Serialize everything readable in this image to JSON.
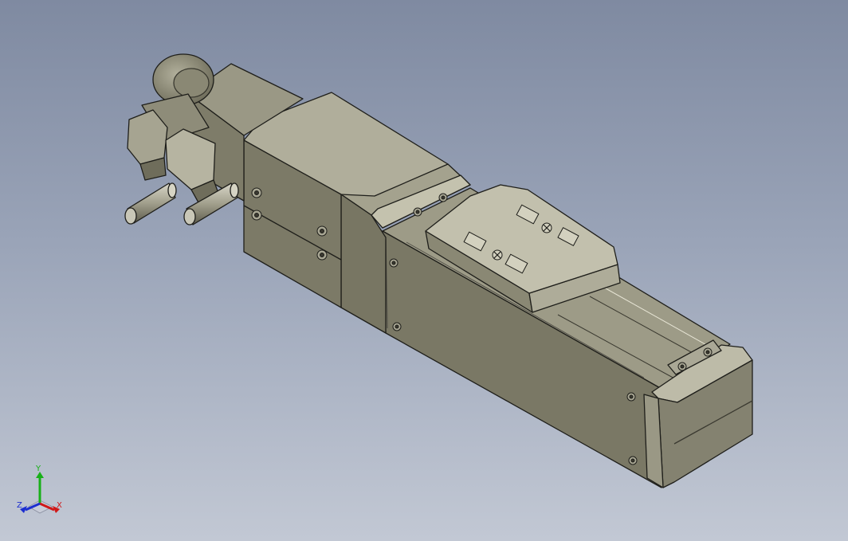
{
  "viewport": {
    "background_top": "#7f8aa1",
    "background_bottom": "#c2c8d4"
  },
  "model": {
    "body_color": "#7a7865",
    "edge_color": "#1e1e1a"
  },
  "triad": {
    "x_label": "X",
    "y_label": "Y",
    "z_label": "Z",
    "x_color": "#d01818",
    "y_color": "#18b018",
    "z_color": "#1c2ed0"
  }
}
